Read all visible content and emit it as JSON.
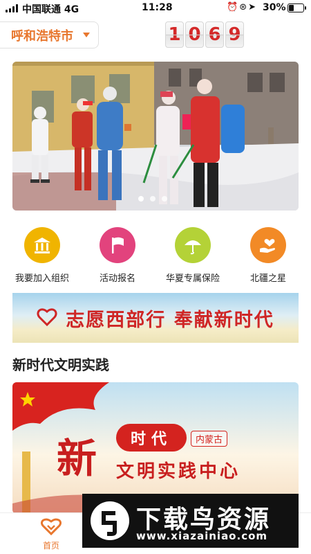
{
  "status_bar": {
    "carrier": "中国联通 4G",
    "time": "11:28",
    "battery": "30%",
    "battery_level": 0.3,
    "icons": [
      "alarm-icon",
      "rotation-lock-icon",
      "location-icon"
    ]
  },
  "header": {
    "city": "呼和浩特市",
    "counter_digits": [
      "1",
      "0",
      "6",
      "9"
    ],
    "accent_color": "#e8772e"
  },
  "banner": {
    "slide_count": 3,
    "active_slide": 0
  },
  "quick_menu": [
    {
      "label": "我要加入组织",
      "icon": "building-icon",
      "color": "#f0b400"
    },
    {
      "label": "活动报名",
      "icon": "flag-icon",
      "color": "#e2437d"
    },
    {
      "label": "华夏专属保险",
      "icon": "umbrella-icon",
      "color": "#b4d237"
    },
    {
      "label": "北疆之星",
      "icon": "hand-heart-icon",
      "color": "#f28a26"
    }
  ],
  "slogan": {
    "text": "志愿西部行 奉献新时代"
  },
  "section": {
    "title": "新时代文明实践"
  },
  "feature_card": {
    "title_char": "新",
    "pill_text": "时代",
    "tag": "内蒙古",
    "subtitle": "文明实践中心"
  },
  "tab_bar": {
    "home_label": "首页"
  },
  "watermark": {
    "text": "下载鸟资源",
    "url": "www.xiazainiao.com"
  }
}
